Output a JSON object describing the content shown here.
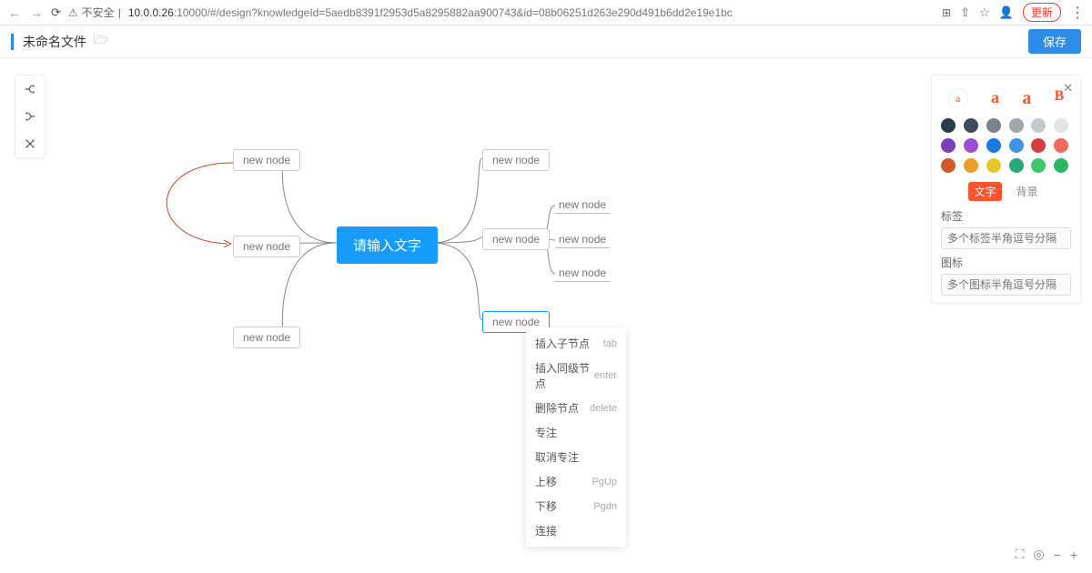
{
  "browser": {
    "security_label": "不安全",
    "url_host": "10.0.0.26",
    "url_rest": ":10000/#/design?knowledgeId=5aedb8391f2953d5a8295882aa900743&id=08b06251d263e290d491b6dd2e19e1bc",
    "update_label": "更新"
  },
  "header": {
    "filename": "未命名文件",
    "save": "保存"
  },
  "mindmap": {
    "center": "请输入文字",
    "node_label": "new node",
    "grandchildren": [
      "new node",
      "new node",
      "new node"
    ]
  },
  "context_menu": [
    {
      "label": "插入子节点",
      "shortcut": "tab"
    },
    {
      "label": "插入同级节点",
      "shortcut": "enter"
    },
    {
      "label": "删除节点",
      "shortcut": "delete"
    },
    {
      "label": "专注",
      "shortcut": ""
    },
    {
      "label": "取消专注",
      "shortcut": ""
    },
    {
      "label": "上移",
      "shortcut": "PgUp"
    },
    {
      "label": "下移",
      "shortcut": "Pgdn"
    },
    {
      "label": "连接",
      "shortcut": ""
    }
  ],
  "panel": {
    "font_sizes": [
      "a",
      "a",
      "a",
      "B"
    ],
    "colors": [
      "#2a3b4c",
      "#3d4a5c",
      "#7b828a",
      "#a1a7ad",
      "#c5c9cc",
      "#e1e3e5",
      "#7b3fb8",
      "#9b4fd1",
      "#1b7ae0",
      "#3f93e0",
      "#d43e3e",
      "#ee6a5a",
      "#d2572a",
      "#eb9e2e",
      "#e6c72b",
      "#2ba87a",
      "#3fc76b",
      "#28b862"
    ],
    "tab_text": "文字",
    "tab_bg": "背景",
    "label_title": "标签",
    "label_placeholder": "多个标签半角逗号分隔",
    "icon_title": "图标",
    "icon_placeholder": "多个图标半角逗号分隔"
  }
}
